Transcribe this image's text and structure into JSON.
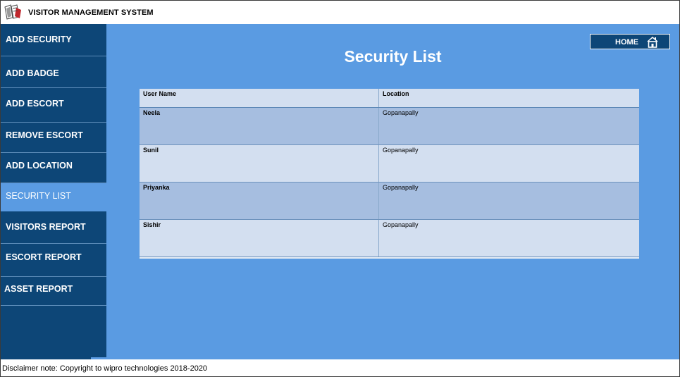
{
  "app": {
    "title": "VISITOR MANAGEMENT SYSTEM"
  },
  "sidebar": {
    "items": [
      {
        "label": "ADD SECURITY"
      },
      {
        "label": "ADD BADGE"
      },
      {
        "label": "ADD ESCORT"
      },
      {
        "label": "REMOVE ESCORT"
      },
      {
        "label": "ADD LOCATION"
      },
      {
        "label": "SECURITY LIST",
        "active": true
      },
      {
        "label": "VISITORS REPORT"
      },
      {
        "label": "ESCORT REPORT"
      },
      {
        "label": "ASSET REPORT"
      }
    ]
  },
  "header": {
    "home_label": "HOME",
    "home_icon": "home-icon"
  },
  "main": {
    "title": "Security List",
    "table": {
      "columns": [
        "User Name",
        "Location"
      ],
      "rows": [
        [
          "Neela",
          "Gopanapally"
        ],
        [
          "Sunil",
          "Gopanapally"
        ],
        [
          "Priyanka",
          "Gopanapally"
        ],
        [
          "Sishir",
          "Gopanapally"
        ]
      ]
    }
  },
  "footer": {
    "disclaimer": "Disclaimer note: Copyright to wipro technologies 2018-2020"
  },
  "colors": {
    "sidebar": "#0d4677",
    "main": "#5a9be2",
    "row_alt": "#a6bee0",
    "row": "#d3dff0"
  }
}
